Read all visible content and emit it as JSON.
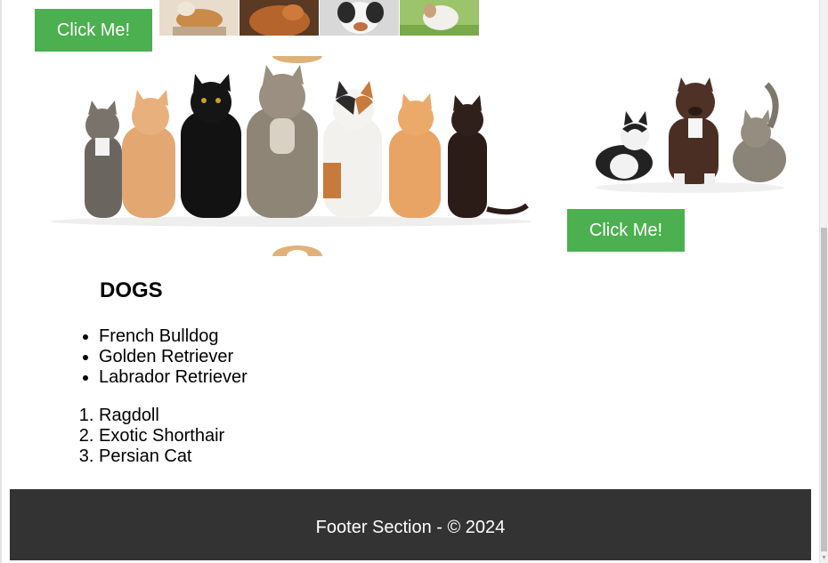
{
  "buttons": {
    "top_label": "Click Me!",
    "mid_label": "Click Me!"
  },
  "section": {
    "heading": "DOGS"
  },
  "dog_list": [
    "French Bulldog",
    "Golden Retriever",
    "Labrador Retriever"
  ],
  "cat_list": [
    "Ragdoll",
    "Exotic Shorthair",
    "Persian Cat"
  ],
  "footer": {
    "text": "Footer Section - © 2024"
  },
  "colors": {
    "button": "#4caf50",
    "footer_bg": "#333333"
  }
}
